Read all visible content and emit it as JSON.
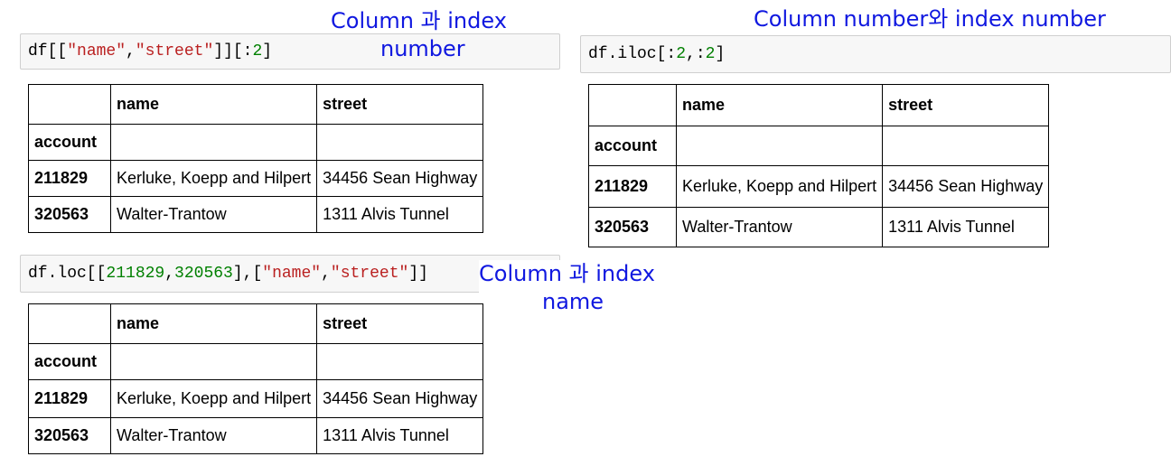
{
  "cells": [
    {
      "code_tokens": [
        {
          "text": "df[[",
          "kind": "op"
        },
        {
          "text": "\"name\"",
          "kind": "str"
        },
        {
          "text": ",",
          "kind": "op"
        },
        {
          "text": "\"street\"",
          "kind": "str"
        },
        {
          "text": "]][:",
          "kind": "op"
        },
        {
          "text": "2",
          "kind": "num"
        },
        {
          "text": "]",
          "kind": "op"
        }
      ],
      "annotation": [
        "Column 과 index",
        "number"
      ],
      "table": {
        "columns": [
          "",
          "name",
          "street"
        ],
        "index_name": "account",
        "rows": [
          {
            "index": "211829",
            "name": "Kerluke, Koepp and Hilpert",
            "street": "34456 Sean Highway"
          },
          {
            "index": "320563",
            "name": "Walter-Trantow",
            "street": "1311 Alvis Tunnel"
          }
        ]
      }
    },
    {
      "code_tokens": [
        {
          "text": "df.iloc[:",
          "kind": "op"
        },
        {
          "text": "2",
          "kind": "num"
        },
        {
          "text": ",:",
          "kind": "op"
        },
        {
          "text": "2",
          "kind": "num"
        },
        {
          "text": "]",
          "kind": "op"
        }
      ],
      "annotation": [
        "Column number와 index number"
      ],
      "table": {
        "columns": [
          "",
          "name",
          "street"
        ],
        "index_name": "account",
        "rows": [
          {
            "index": "211829",
            "name": "Kerluke, Koepp and Hilpert",
            "street": "34456 Sean Highway"
          },
          {
            "index": "320563",
            "name": "Walter-Trantow",
            "street": "1311 Alvis Tunnel"
          }
        ]
      }
    },
    {
      "code_tokens": [
        {
          "text": "df.loc[[",
          "kind": "op"
        },
        {
          "text": "211829",
          "kind": "num"
        },
        {
          "text": ",",
          "kind": "op"
        },
        {
          "text": "320563",
          "kind": "num"
        },
        {
          "text": "],[",
          "kind": "op"
        },
        {
          "text": "\"name\"",
          "kind": "str"
        },
        {
          "text": ",",
          "kind": "op"
        },
        {
          "text": "\"street\"",
          "kind": "str"
        },
        {
          "text": "]]",
          "kind": "op"
        }
      ],
      "annotation": [
        "Column 과 index",
        "name"
      ],
      "table": {
        "columns": [
          "",
          "name",
          "street"
        ],
        "index_name": "account",
        "rows": [
          {
            "index": "211829",
            "name": "Kerluke, Koepp and Hilpert",
            "street": "34456 Sean Highway"
          },
          {
            "index": "320563",
            "name": "Walter-Trantow",
            "street": "1311 Alvis Tunnel"
          }
        ]
      }
    }
  ],
  "colors": {
    "annotation": "#1018e0",
    "string_token": "#ba2121",
    "number_token": "#008000"
  }
}
